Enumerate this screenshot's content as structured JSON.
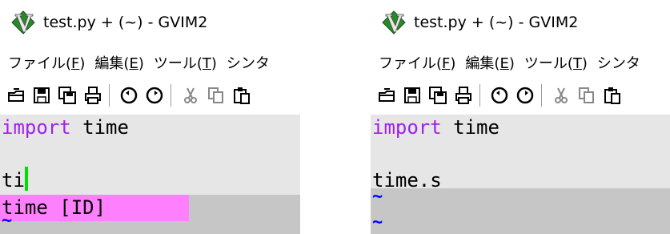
{
  "colors": {
    "keyword": "#a020f0",
    "cursor": "#00e000",
    "popup_menu_bg": "#ff80ff",
    "nontext_tilde": "#0000ff",
    "editor_bg": "#e6e6e6",
    "nontext_bg": "#c6c6c6"
  },
  "windows": [
    {
      "title": "test.py + (~) - GVIM2",
      "menu": [
        {
          "text": "ファイル(",
          "acc": "F",
          "tail": ")"
        },
        {
          "text": "編集(",
          "acc": "E",
          "tail": ")"
        },
        {
          "text": "ツール(",
          "acc": "T",
          "tail": ")"
        },
        {
          "text": "シンタ",
          "acc": "",
          "tail": ""
        }
      ],
      "toolbar_icons": [
        "open-icon",
        "save-icon",
        "save-all-icon",
        "print-icon",
        "undo-icon",
        "redo-icon",
        "cut-icon",
        "copy-icon",
        "paste-icon"
      ],
      "editor": {
        "line1_kw": "import",
        "line1_rest": " time",
        "line3_text": "ti",
        "popup_item": "time [ID]",
        "tilde": "~"
      }
    },
    {
      "title": "test.py + (~) - GVIM2",
      "menu": [
        {
          "text": "ファイル(",
          "acc": "F",
          "tail": ")"
        },
        {
          "text": "編集(",
          "acc": "E",
          "tail": ")"
        },
        {
          "text": "ツール(",
          "acc": "T",
          "tail": ")"
        },
        {
          "text": "シンタ",
          "acc": "",
          "tail": ""
        }
      ],
      "toolbar_icons": [
        "open-icon",
        "save-icon",
        "save-all-icon",
        "print-icon",
        "undo-icon",
        "redo-icon",
        "cut-icon",
        "copy-icon",
        "paste-icon"
      ],
      "editor": {
        "line1_kw": "import",
        "line1_rest": " time",
        "line3_text": "time.s",
        "tilde1": "~",
        "tilde2": "~"
      }
    }
  ]
}
